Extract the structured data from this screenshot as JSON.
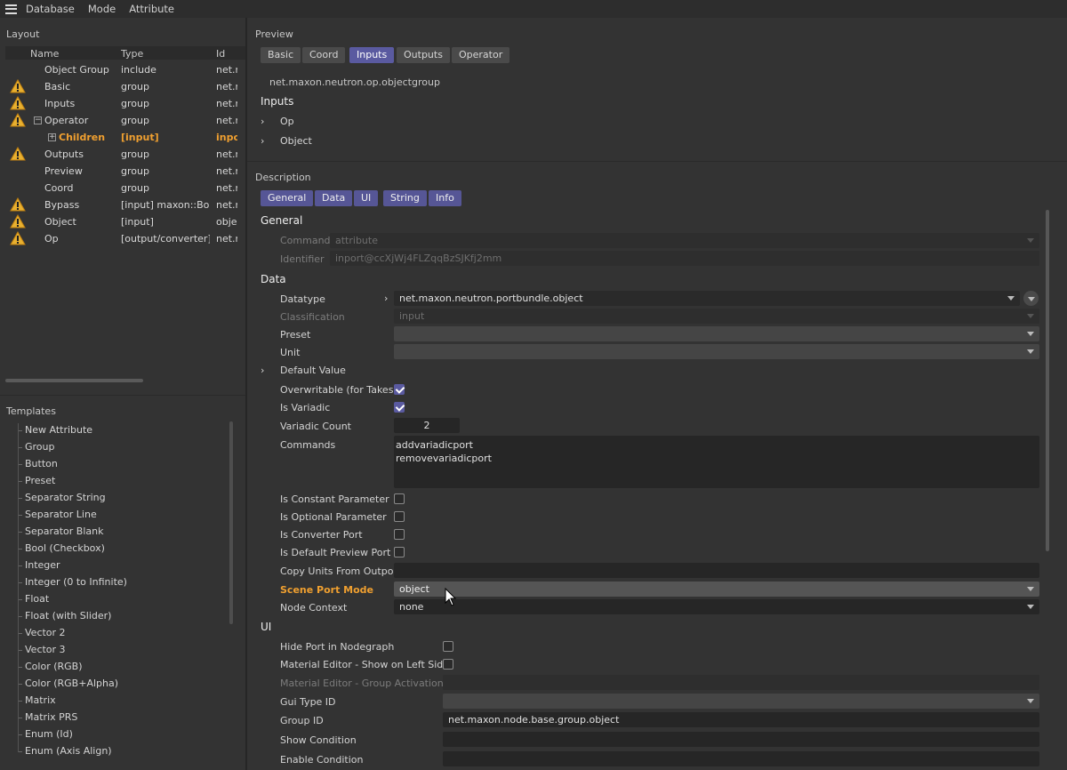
{
  "menubar": {
    "items": [
      "Database",
      "Mode",
      "Attribute"
    ]
  },
  "layout": {
    "section_label": "Layout",
    "columns": {
      "name": "Name",
      "type": "Type",
      "id": "Id"
    },
    "rows": [
      {
        "name": "Object Group",
        "type": "include",
        "id": "net.r",
        "warn": false
      },
      {
        "name": "Basic",
        "type": "group",
        "id": "net.r",
        "warn": true
      },
      {
        "name": "Inputs",
        "type": "group",
        "id": "net.r",
        "warn": true
      },
      {
        "name": "Operator",
        "type": "group",
        "id": "net.r",
        "warn": true
      },
      {
        "name": "Children",
        "type": "[input]",
        "id": "inpo",
        "warn": false
      },
      {
        "name": "Outputs",
        "type": "group",
        "id": "net.r",
        "warn": true
      },
      {
        "name": "Preview",
        "type": "group",
        "id": "net.r",
        "warn": false
      },
      {
        "name": "Coord",
        "type": "group",
        "id": "net.r",
        "warn": false
      },
      {
        "name": "Bypass",
        "type": "[input] maxon::Bool",
        "id": "net.r",
        "warn": true
      },
      {
        "name": "Object",
        "type": "[input]",
        "id": "obje",
        "warn": true
      },
      {
        "name": "Op",
        "type": "[output/converter]",
        "id": "net.r",
        "warn": true
      }
    ]
  },
  "templates": {
    "section_label": "Templates",
    "items": [
      "New Attribute",
      "Group",
      "Button",
      "Preset",
      "Separator String",
      "Separator Line",
      "Separator Blank",
      "Bool (Checkbox)",
      "Integer",
      "Integer (0 to Infinite)",
      "Float",
      "Float (with Slider)",
      "Vector 2",
      "Vector 3",
      "Color (RGB)",
      "Color (RGB+Alpha)",
      "Matrix",
      "Matrix PRS",
      "Enum (Id)",
      "Enum (Axis Align)"
    ]
  },
  "preview": {
    "section_label": "Preview",
    "tabs": [
      "Basic",
      "Coord",
      "Inputs",
      "Outputs",
      "Operator"
    ],
    "active_tab": "Inputs",
    "node_id": "net.maxon.neutron.op.objectgroup",
    "heading": "Inputs",
    "items": [
      "Op",
      "Object"
    ]
  },
  "description": {
    "section_label": "Description",
    "tabs": [
      "General",
      "Data",
      "UI",
      "String",
      "Info"
    ],
    "general": {
      "heading": "General",
      "command_label": "Command",
      "command_value": "attribute",
      "identifier_label": "Identifier",
      "identifier_value": "inport@ccXjWj4FLZqqBzSJKfj2mm"
    },
    "data": {
      "heading": "Data",
      "datatype_label": "Datatype",
      "datatype_value": "net.maxon.neutron.portbundle.object",
      "classification_label": "Classification",
      "classification_value": "input",
      "preset_label": "Preset",
      "preset_value": "",
      "unit_label": "Unit",
      "unit_value": "",
      "default_value_label": "Default Value",
      "overwritable_label": "Overwritable (for Takes)",
      "overwritable": true,
      "is_variadic_label": "Is Variadic",
      "is_variadic": true,
      "variadic_count_label": "Variadic Count",
      "variadic_count": "2",
      "commands_label": "Commands",
      "commands": [
        "addvariadicport",
        "removevariadicport"
      ],
      "is_constant_label": "Is Constant Parameter",
      "is_constant": false,
      "is_optional_label": "Is Optional Parameter",
      "is_optional": false,
      "is_converter_label": "Is Converter Port",
      "is_converter": false,
      "is_default_preview_label": "Is Default Preview Port",
      "is_default_preview": false,
      "copy_units_label": "Copy Units From Outport",
      "copy_units_value": "",
      "scene_port_mode_label": "Scene Port Mode",
      "scene_port_mode_value": "object",
      "node_context_label": "Node Context",
      "node_context_value": "none"
    },
    "ui": {
      "heading": "UI",
      "hide_port_label": "Hide Port in Nodegraph",
      "hide_port": false,
      "mat_left_label": "Material Editor - Show on Left Side",
      "mat_left": false,
      "mat_group_label": "Material Editor - Group Activation ID",
      "mat_group_value": "",
      "gui_type_label": "Gui Type ID",
      "gui_type_value": "",
      "group_id_label": "Group ID",
      "group_id_value": "net.maxon.node.base.group.object",
      "show_cond_label": "Show Condition",
      "show_cond_value": "",
      "enable_cond_label": "Enable Condition",
      "enable_cond_value": ""
    }
  }
}
